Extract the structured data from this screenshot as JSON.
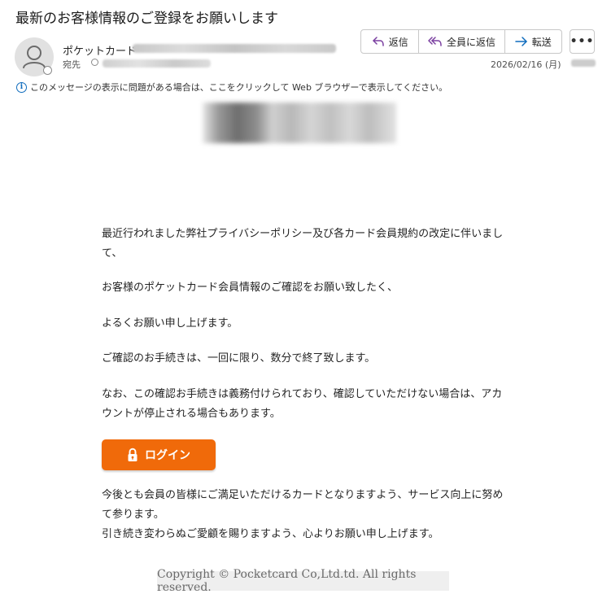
{
  "subject": "最新のお客様情報のご登録をお願いします",
  "sender": {
    "name": "ポケットカード"
  },
  "recipients": {
    "label": "宛先"
  },
  "toolbar": {
    "reply_label": "返信",
    "reply_all_label": "全員に返信",
    "forward_label": "転送",
    "more_label": "•••"
  },
  "date": "2026/02/16 (月)",
  "info_bar": {
    "text": "このメッセージの表示に問題がある場合は、ここをクリックして Web ブラウザーで表示してください。"
  },
  "body": {
    "p1": "最近行われました弊社プライバシーポリシー及び各カード会員規約の改定に伴いまして、",
    "p2": "お客様のポケットカード会員情報のご確認をお願い致したく、",
    "p3": "よるくお願い申し上げます。",
    "p4": "ご確認のお手続きは、一回に限り、数分で終了致します。",
    "p5": "なお、この確認お手続きは義務付けられており、確認していただけない場合は、アカウントが停止される場合もあります。",
    "login_label": "ログイン",
    "p6a": "今後とも会員の皆様にご満足いただけるカードとなりますよう、サービス向上に努めて参ります。",
    "p6b": "引き続き変わらぬご愛顧を賜りますよう、心よりお願い申し上げます。"
  },
  "footer": {
    "copyright": "Copyright © Pocketcard Co,Ltd.td. All rights reserved."
  },
  "colors": {
    "accent": "#0f6cbd",
    "login_button": "#f06a0a"
  }
}
